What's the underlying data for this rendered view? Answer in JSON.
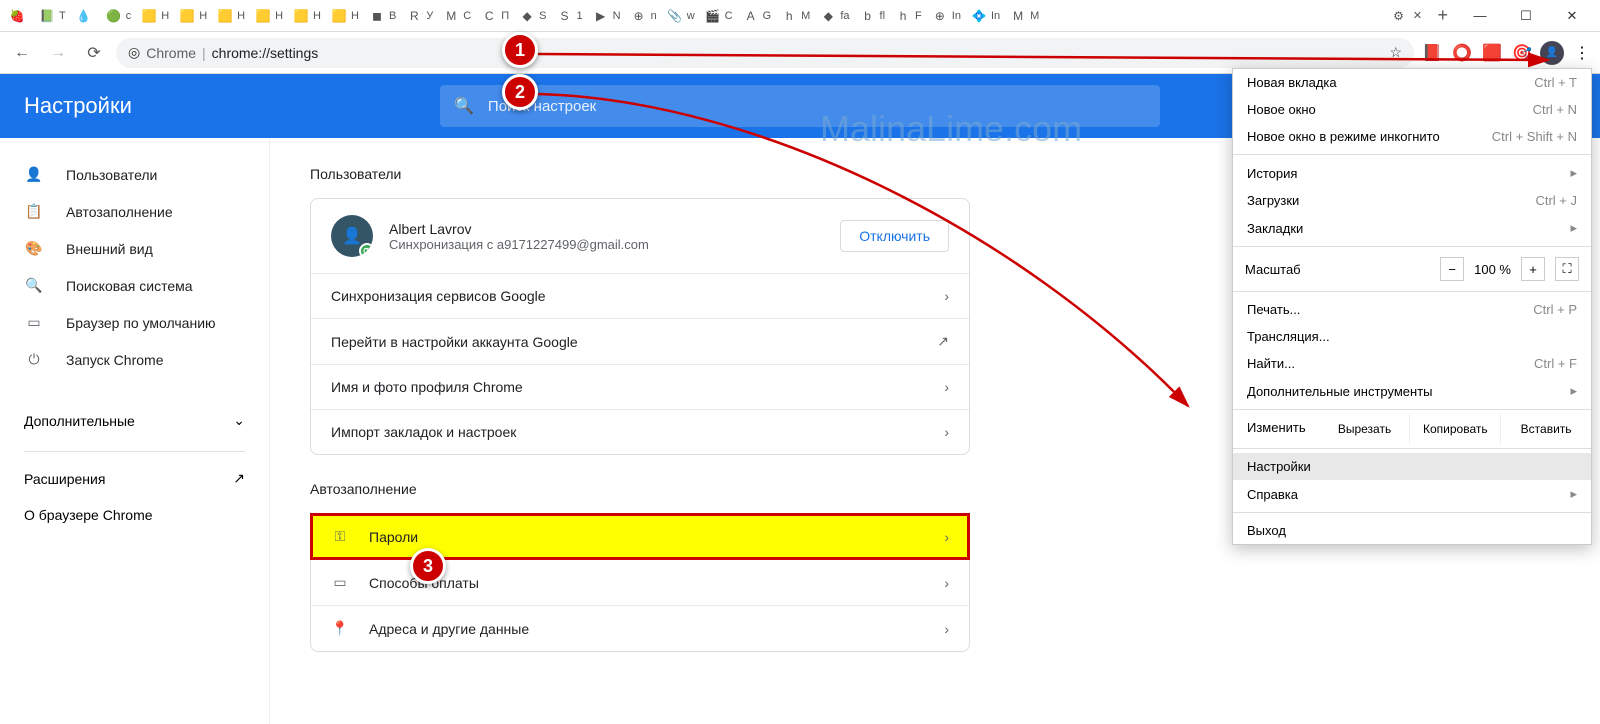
{
  "window": {
    "minimize": "—",
    "maximize": "☐",
    "close": "✕"
  },
  "tabs": [
    {
      "title": "",
      "icon": "🍓"
    },
    {
      "title": "Т",
      "icon": "📗"
    },
    {
      "title": "",
      "icon": "💧"
    },
    {
      "title": "c",
      "icon": "🟢"
    },
    {
      "title": "Н",
      "icon": "🟨"
    },
    {
      "title": "Н",
      "icon": "🟨"
    },
    {
      "title": "Н",
      "icon": "🟨"
    },
    {
      "title": "Н",
      "icon": "🟨"
    },
    {
      "title": "Н",
      "icon": "🟨"
    },
    {
      "title": "Н",
      "icon": "🟨"
    },
    {
      "title": "В",
      "icon": "◼"
    },
    {
      "title": "У",
      "icon": "R"
    },
    {
      "title": "С",
      "icon": "M"
    },
    {
      "title": "П",
      "icon": "C"
    },
    {
      "title": "S",
      "icon": "◆"
    },
    {
      "title": "1",
      "icon": "S"
    },
    {
      "title": "N",
      "icon": "▶"
    },
    {
      "title": "n",
      "icon": "⊕"
    },
    {
      "title": "w",
      "icon": "📎"
    },
    {
      "title": "C",
      "icon": "🎬"
    },
    {
      "title": "G",
      "icon": "A"
    },
    {
      "title": "M",
      "icon": "h"
    },
    {
      "title": "fa",
      "icon": "◆"
    },
    {
      "title": "fl",
      "icon": "b"
    },
    {
      "title": "F",
      "icon": "h"
    },
    {
      "title": "In",
      "icon": "⊕"
    },
    {
      "title": "In",
      "icon": "💠"
    },
    {
      "title": "M",
      "icon": "M"
    }
  ],
  "active_tab": {
    "icon": "⚙",
    "close": "✕"
  },
  "newtab": "+",
  "omnibox": {
    "scheme_label": "Chrome",
    "url": "chrome://settings",
    "star": "☆"
  },
  "extensions": [
    "📕",
    "⭕",
    "🟥",
    "🎯"
  ],
  "settings_title": "Настройки",
  "search": {
    "placeholder": "Поиск настроек"
  },
  "sidebar": {
    "items": [
      {
        "icon": "👤",
        "label": "Пользователи"
      },
      {
        "icon": "📋",
        "label": "Автозаполнение"
      },
      {
        "icon": "🎨",
        "label": "Внешний вид"
      },
      {
        "icon": "🔍",
        "label": "Поисковая система"
      },
      {
        "icon": "▭",
        "label": "Браузер по умолчанию"
      },
      {
        "icon": "⏻",
        "label": "Запуск Chrome"
      }
    ],
    "expand": "Дополнительные",
    "extensions": "Расширения",
    "about": "О браузере Chrome"
  },
  "users_section": {
    "title": "Пользователи",
    "name": "Albert Lavrov",
    "sync": "Синхронизация с a9171227499@gmail.com",
    "disconnect": "Отключить",
    "rows": [
      "Синхронизация сервисов Google",
      "Перейти в настройки аккаунта Google",
      "Имя и фото профиля Chrome",
      "Импорт закладок и настроек"
    ]
  },
  "autofill_section": {
    "title": "Автозаполнение",
    "rows": [
      {
        "icon": "⚿",
        "label": "Пароли",
        "hl": true
      },
      {
        "icon": "▭",
        "label": "Способы оплаты",
        "hl": false
      },
      {
        "icon": "📍",
        "label": "Адреса и другие данные",
        "hl": false
      }
    ]
  },
  "menu": {
    "new_tab": "Новая вкладка",
    "new_tab_sc": "Ctrl + T",
    "new_window": "Новое окно",
    "new_window_sc": "Ctrl + N",
    "incognito": "Новое окно в режиме инкогнито",
    "incognito_sc": "Ctrl + Shift + N",
    "history": "История",
    "downloads": "Загрузки",
    "downloads_sc": "Ctrl + J",
    "bookmarks": "Закладки",
    "zoom": "Масштаб",
    "zoom_val": "100 %",
    "zoom_minus": "−",
    "zoom_plus": "+",
    "fullscreen": "⛶",
    "print": "Печать...",
    "print_sc": "Ctrl + P",
    "cast": "Трансляция...",
    "find": "Найти...",
    "find_sc": "Ctrl + F",
    "more_tools": "Дополнительные инструменты",
    "edit_label": "Изменить",
    "cut": "Вырезать",
    "copy": "Копировать",
    "paste": "Вставить",
    "settings": "Настройки",
    "help": "Справка",
    "exit": "Выход"
  },
  "markers": {
    "m1": "1",
    "m2": "2",
    "m3": "3"
  },
  "watermark": "MalinaLime.com"
}
